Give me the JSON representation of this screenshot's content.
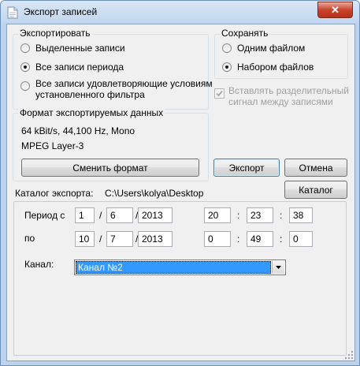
{
  "window": {
    "title": "Экспорт записей",
    "close_glyph": "✕"
  },
  "export_group": {
    "legend": "Экспортировать",
    "options": [
      {
        "label": "Выделенные записи",
        "checked": false
      },
      {
        "label": "Все записи периода",
        "checked": true
      },
      {
        "label_line1": "Все записи удовлетворяющие условиям",
        "label_line2": "установленного фильтра",
        "checked": false
      }
    ]
  },
  "save_group": {
    "legend": "Сохранять",
    "options": [
      {
        "label": "Одним файлом",
        "checked": false
      },
      {
        "label": "Набором файлов",
        "checked": true
      }
    ],
    "separator_line1": "Вставлять разделительный",
    "separator_line2": "сигнал между записями",
    "separator_checked": true,
    "separator_enabled": false
  },
  "format_group": {
    "legend": "Формат экспортируемых данных",
    "line1": "64 kBit/s, 44,100 Hz, Mono",
    "line2": "MPEG Layer-3",
    "change_button": "Сменить формат"
  },
  "buttons": {
    "export": "Экспорт",
    "cancel": "Отмена",
    "catalog": "Каталог"
  },
  "catalog": {
    "label": "Каталог экспорта:",
    "path": "C:\\Users\\kolya\\Desktop"
  },
  "period": {
    "from_label": "Период с",
    "to_label": "по",
    "date_sep": "/",
    "time_sep": ":",
    "from": {
      "day": "1",
      "month": "6",
      "year": "2013",
      "hour": "20",
      "minute": "23",
      "second": "38"
    },
    "to": {
      "day": "10",
      "month": "7",
      "year": "2013",
      "hour": "0",
      "minute": "49",
      "second": "0"
    },
    "channel_label": "Канал:",
    "channel_value": "Канал №2"
  }
}
